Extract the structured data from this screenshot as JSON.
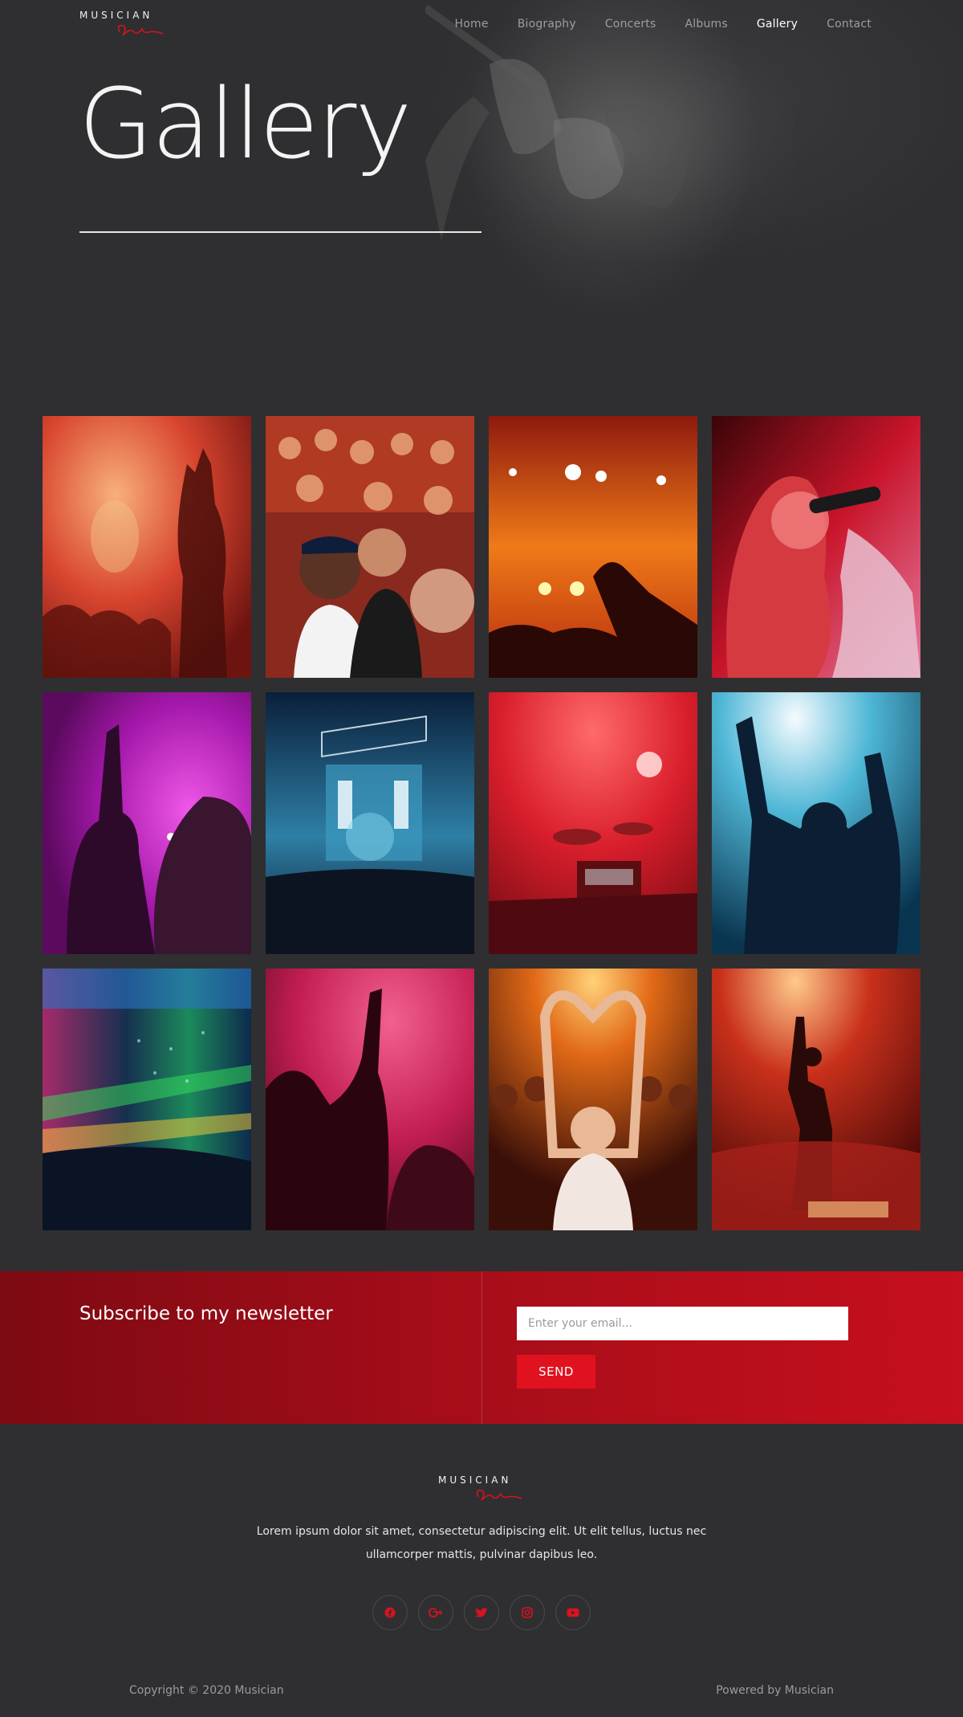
{
  "brand": {
    "logo_text": "MUSICIAN",
    "accent_color": "#e0121f",
    "background_color": "#2f2f31"
  },
  "nav": {
    "items": [
      {
        "label": "Home"
      },
      {
        "label": "Biography"
      },
      {
        "label": "Concerts"
      },
      {
        "label": "Albums"
      },
      {
        "label": "Gallery",
        "active": true
      },
      {
        "label": "Contact"
      }
    ]
  },
  "hero": {
    "title": "Gallery"
  },
  "gallery": {
    "images": [
      {
        "name": "crowd-orange-hands"
      },
      {
        "name": "crowd-cheering-fans"
      },
      {
        "name": "stage-lights-hand"
      },
      {
        "name": "singer-red-microphone"
      },
      {
        "name": "crowd-magenta-hand"
      },
      {
        "name": "blue-stage-festival"
      },
      {
        "name": "red-drum-kit-stage"
      },
      {
        "name": "blue-raised-hands"
      },
      {
        "name": "colorful-laser-crowd"
      },
      {
        "name": "pink-crowd-dancing"
      },
      {
        "name": "girl-heart-hands"
      },
      {
        "name": "performer-red-stage"
      }
    ]
  },
  "newsletter": {
    "title": "Subscribe to my newsletter",
    "email_placeholder": "Enter your email...",
    "send_label": "SEND"
  },
  "footer": {
    "logo_text": "MUSICIAN",
    "description": "Lorem ipsum dolor sit amet, consectetur adipiscing elit. Ut elit tellus, luctus nec ullamcorper mattis, pulvinar dapibus leo.",
    "socials": [
      {
        "icon": "facebook-icon"
      },
      {
        "icon": "google-plus-icon"
      },
      {
        "icon": "twitter-icon"
      },
      {
        "icon": "instagram-icon"
      },
      {
        "icon": "youtube-icon"
      }
    ],
    "copyright": "Copyright © 2020 Musician",
    "powered": "Powered by Musician"
  }
}
